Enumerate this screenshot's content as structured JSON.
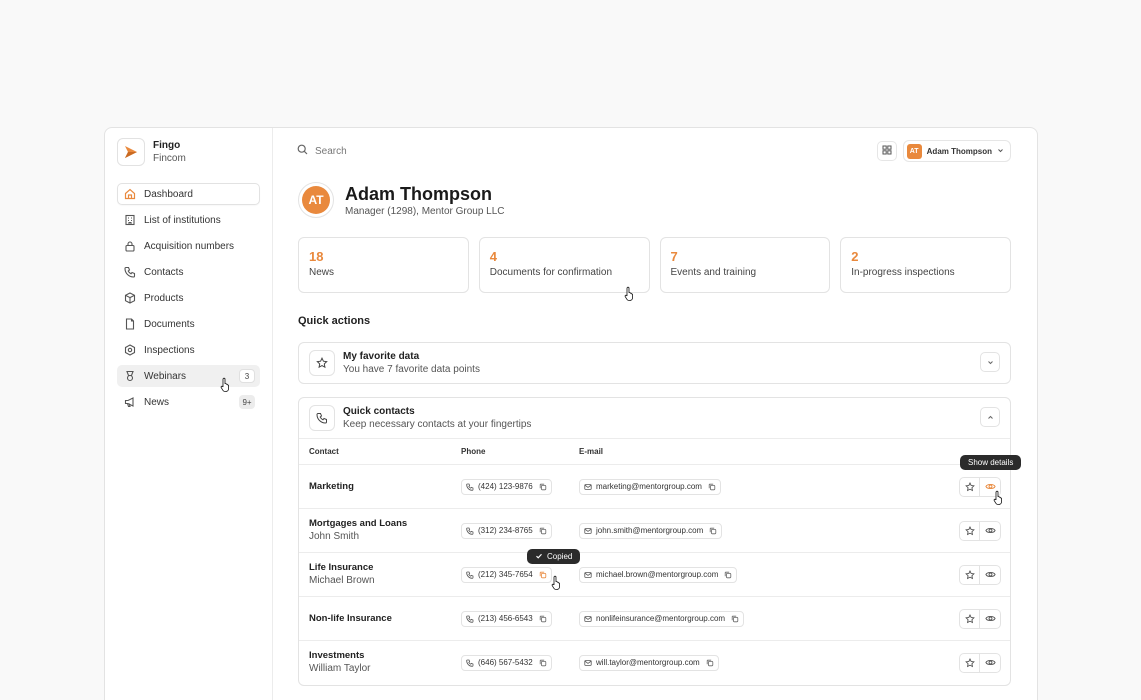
{
  "brand": {
    "name": "Fingo",
    "sub": "Fincom",
    "accent": "#e9893d"
  },
  "sidebar": {
    "items": [
      {
        "label": "Dashboard",
        "icon": "home-icon",
        "active": true
      },
      {
        "label": "List of institutions",
        "icon": "building-icon"
      },
      {
        "label": "Acquisition numbers",
        "icon": "lock-icon"
      },
      {
        "label": "Contacts",
        "icon": "phone-icon"
      },
      {
        "label": "Products",
        "icon": "box-icon"
      },
      {
        "label": "Documents",
        "icon": "document-icon"
      },
      {
        "label": "Inspections",
        "icon": "camera-icon"
      },
      {
        "label": "Webinars",
        "icon": "award-icon",
        "badge": "3",
        "hover": true
      },
      {
        "label": "News",
        "icon": "megaphone-icon",
        "badge": "9+"
      }
    ]
  },
  "topbar": {
    "search_placeholder": "Search",
    "user_initials": "AT",
    "user_name": "Adam Thompson"
  },
  "profile": {
    "initials": "AT",
    "name": "Adam Thompson",
    "role": "Manager (1298), Mentor Group LLC"
  },
  "stats": [
    {
      "value": "18",
      "label": "News"
    },
    {
      "value": "4",
      "label": "Documents for confirmation"
    },
    {
      "value": "7",
      "label": "Events and training"
    },
    {
      "value": "2",
      "label": "In-progress inspections"
    }
  ],
  "quick_actions": {
    "title": "Quick actions",
    "favorite": {
      "title": "My favorite data",
      "subtitle": "You have 7 favorite data points"
    },
    "contacts": {
      "title": "Quick contacts",
      "subtitle": "Keep necessary contacts at your fingertips",
      "columns": {
        "contact": "Contact",
        "phone": "Phone",
        "email": "E-mail"
      },
      "rows": [
        {
          "name": "Marketing",
          "person": "",
          "phone": "(424) 123-9876",
          "email": "marketing@mentorgroup.com"
        },
        {
          "name": "Mortgages and Loans",
          "person": "John Smith",
          "phone": "(312) 234-8765",
          "email": "john.smith@mentorgroup.com"
        },
        {
          "name": "Life Insurance",
          "person": "Michael Brown",
          "phone": "(212) 345-7654",
          "email": "michael.brown@mentorgroup.com"
        },
        {
          "name": "Non-life Insurance",
          "person": "",
          "phone": "(213) 456-6543",
          "email": "nonlifeinsurance@mentorgroup.com"
        },
        {
          "name": "Investments",
          "person": "William Taylor",
          "phone": "(646) 567-5432",
          "email": "will.taylor@mentorgroup.com"
        }
      ]
    }
  },
  "tooltips": {
    "show_details": "Show details",
    "copied": "Copied"
  }
}
